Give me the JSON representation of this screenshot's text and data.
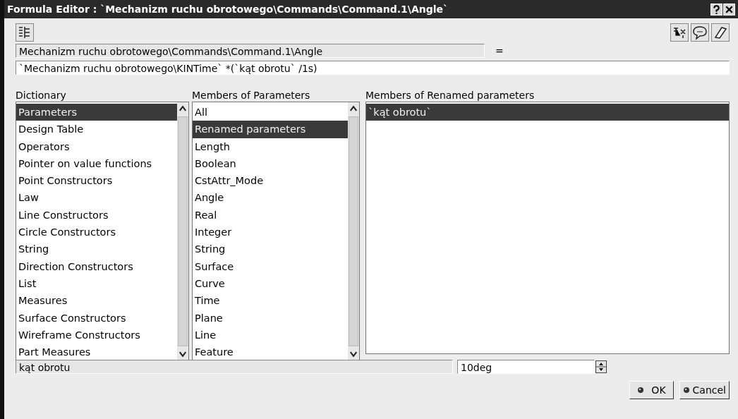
{
  "window": {
    "title": "Formula Editor : `Mechanizm ruchu obrotowego\\Commands\\Command.1\\Angle`"
  },
  "parameter_name": {
    "value": "Mechanizm ruchu obrotowego\\Commands\\Command.1\\Angle"
  },
  "equals": "=",
  "formula": {
    "value": "`Mechanizm ruchu obrotowego\\KINTime` *(`kąt obrotu` /1s)"
  },
  "dictionary": {
    "heading": "Dictionary",
    "items": [
      {
        "label": "Parameters",
        "selected": true
      },
      {
        "label": "Design Table",
        "selected": false
      },
      {
        "label": "Operators",
        "selected": false
      },
      {
        "label": "Pointer on value functions",
        "selected": false
      },
      {
        "label": "Point Constructors",
        "selected": false
      },
      {
        "label": "Law",
        "selected": false
      },
      {
        "label": "Line Constructors",
        "selected": false
      },
      {
        "label": "Circle Constructors",
        "selected": false
      },
      {
        "label": "String",
        "selected": false
      },
      {
        "label": "Direction Constructors",
        "selected": false
      },
      {
        "label": "List",
        "selected": false
      },
      {
        "label": "Measures",
        "selected": false
      },
      {
        "label": "Surface Constructors",
        "selected": false
      },
      {
        "label": "Wireframe Constructors",
        "selected": false
      },
      {
        "label": "Part Measures",
        "selected": false
      }
    ]
  },
  "members": {
    "heading": "Members of Parameters",
    "items": [
      {
        "label": "All",
        "selected": false
      },
      {
        "label": "Renamed parameters",
        "selected": true
      },
      {
        "label": "Length",
        "selected": false
      },
      {
        "label": "Boolean",
        "selected": false
      },
      {
        "label": "CstAttr_Mode",
        "selected": false
      },
      {
        "label": "Angle",
        "selected": false
      },
      {
        "label": "Real",
        "selected": false
      },
      {
        "label": "Integer",
        "selected": false
      },
      {
        "label": "String",
        "selected": false
      },
      {
        "label": "Surface",
        "selected": false
      },
      {
        "label": "Curve",
        "selected": false
      },
      {
        "label": "Time",
        "selected": false
      },
      {
        "label": "Plane",
        "selected": false
      },
      {
        "label": "Line",
        "selected": false
      },
      {
        "label": "Feature",
        "selected": false
      }
    ]
  },
  "renamed": {
    "heading": "Members of Renamed parameters",
    "items": [
      {
        "label": "`kąt obrotu`",
        "selected": true
      }
    ]
  },
  "selected_name": {
    "value": "kąt obrotu"
  },
  "selected_value": {
    "value": "10deg"
  },
  "buttons": [
    {
      "label": "OK"
    },
    {
      "label": "Cancel"
    }
  ]
}
